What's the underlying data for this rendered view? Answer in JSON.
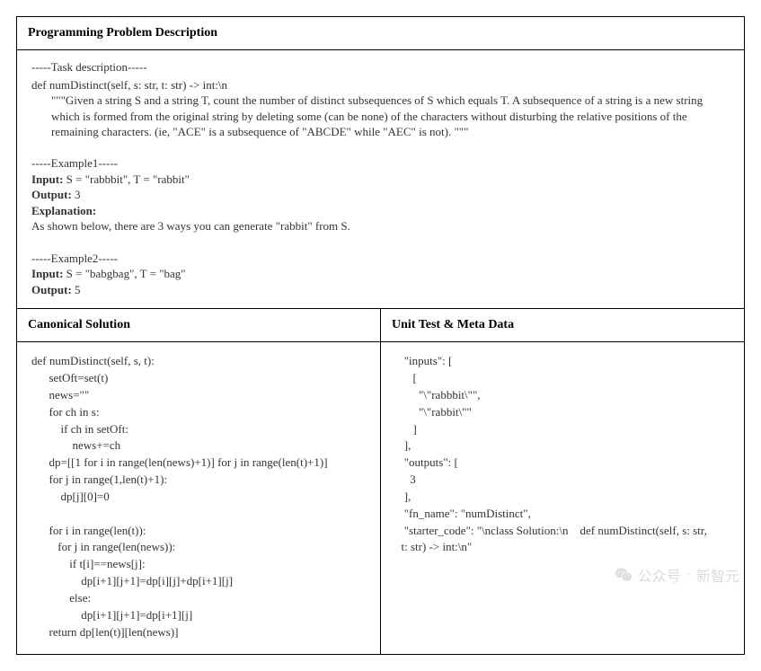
{
  "header": {
    "title": "Programming Problem Description"
  },
  "task": {
    "heading": "-----Task description-----",
    "signature": "def numDistinct(self, s: str, t: str) -> int:\\n",
    "docstring": "\"\"\"Given a string S and a string T, count the number of distinct subsequences of S which equals T. A subsequence of a string is a new string which is formed from the original string by deleting some (can be none) of the characters without disturbing the relative positions of the remaining characters. (ie, \"ACE\" is a subsequence of \"ABCDE\" while \"AEC\" is not). \"\"\""
  },
  "example1": {
    "heading": "-----Example1-----",
    "input_label": "Input:",
    "input_value": " S = \"rabbbit\", T = \"rabbit\"",
    "output_label": "Output:",
    "output_value": " 3",
    "explanation_label": "Explanation:",
    "explanation_value": "As shown below, there are 3 ways you can generate \"rabbit\" from S."
  },
  "example2": {
    "heading": "-----Example2-----",
    "input_label": "Input:",
    "input_value": " S = \"babgbag\", T = \"bag\"",
    "output_label": "Output:",
    "output_value": " 5"
  },
  "columns": {
    "left_title": "Canonical Solution",
    "right_title": "Unit Test & Meta Data"
  },
  "solution_code": "def numDistinct(self, s, t):\n      setOft=set(t)\n      news=\"\"\n      for ch in s:\n          if ch in setOft:\n              news+=ch\n      dp=[[1 for i in range(len(news)+1)] for j in range(len(t)+1)]\n      for j in range(1,len(t)+1):\n          dp[j][0]=0\n\n      for i in range(len(t)):\n         for j in range(len(news)):\n             if t[i]==news[j]:\n                 dp[i+1][j+1]=dp[i][j]+dp[i+1][j]\n             else:\n                 dp[i+1][j+1]=dp[i+1][j]\n      return dp[len(t)][len(news)]",
  "meta_data": "   \"inputs\": [\n      [\n        \"\\\"rabbbit\\\"\",\n        \"\\\"rabbit\\\"\"\n      ]\n   ],\n   \"outputs\": [\n     3\n   ],\n   \"fn_name\": \"numDistinct\",\n   \"starter_code\": \"\\nclass Solution:\\n    def numDistinct(self, s: str,\n  t: str) -> int:\\n\"",
  "watermark": {
    "label": "公众号",
    "dot": "·",
    "account": "新智元"
  }
}
